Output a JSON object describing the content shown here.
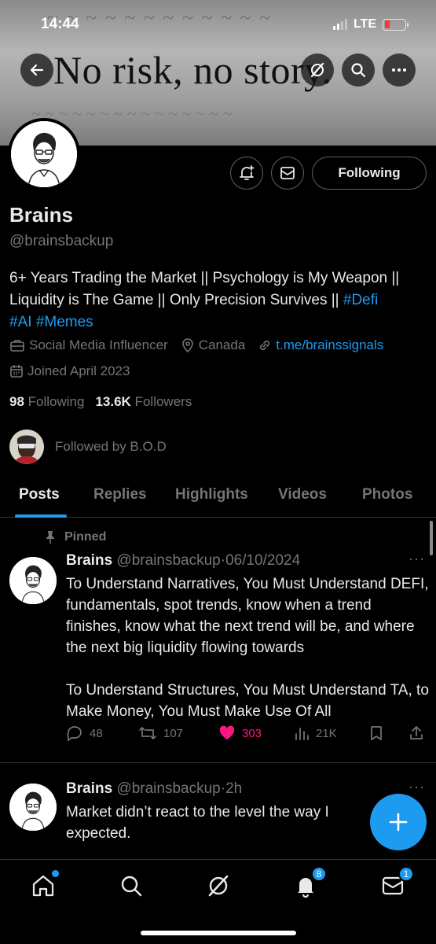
{
  "status_bar": {
    "time": "14:44",
    "network": "LTE"
  },
  "banner": {
    "text": "No risk, no story."
  },
  "header_actions": {
    "following_label": "Following"
  },
  "profile": {
    "name": "Brains",
    "handle": "@brainsbackup",
    "bio_text": "6+ Years Trading the Market || Psychology is My Weapon || Liquidity is The Game || Only Precision Survives || ",
    "bio_hashtags": [
      "#Defi",
      "#AI",
      "#Memes"
    ],
    "category": "Social Media Influencer",
    "location": "Canada",
    "website": "t.me/brainssignals",
    "joined": "Joined April 2023",
    "following_count": "98",
    "following_label": "Following",
    "followers_count": "13.6K",
    "followers_label": "Followers",
    "followed_by": "Followed by B.O.D"
  },
  "tabs": [
    {
      "label": "Posts",
      "active": true
    },
    {
      "label": "Replies"
    },
    {
      "label": "Highlights"
    },
    {
      "label": "Videos"
    },
    {
      "label": "Photos"
    }
  ],
  "posts": [
    {
      "pinned_label": "Pinned",
      "name": "Brains",
      "handle": "@brainsbackup",
      "separator": "·",
      "time": "06/10/2024",
      "text": "To Understand Narratives, You Must Understand DEFI, fundamentals, spot trends, know when a trend finishes, know what the next trend will be, and where the next big liquidity flowing towards\n\nTo Understand Structures, You Must Understand TA, to Make Money, You Must Make Use Of All",
      "replies": "48",
      "reposts": "107",
      "likes": "303",
      "views": "21K"
    },
    {
      "name": "Brains",
      "handle": "@brainsbackup",
      "separator": "·",
      "time": "2h",
      "text": "Market didn’t react to the level the way I expected."
    }
  ],
  "bottom_nav": {
    "notifications_badge": "8",
    "messages_badge": "1"
  },
  "colors": {
    "accent": "#1d9bf0",
    "like": "#f91880",
    "muted": "#71767b",
    "background": "#000000"
  }
}
